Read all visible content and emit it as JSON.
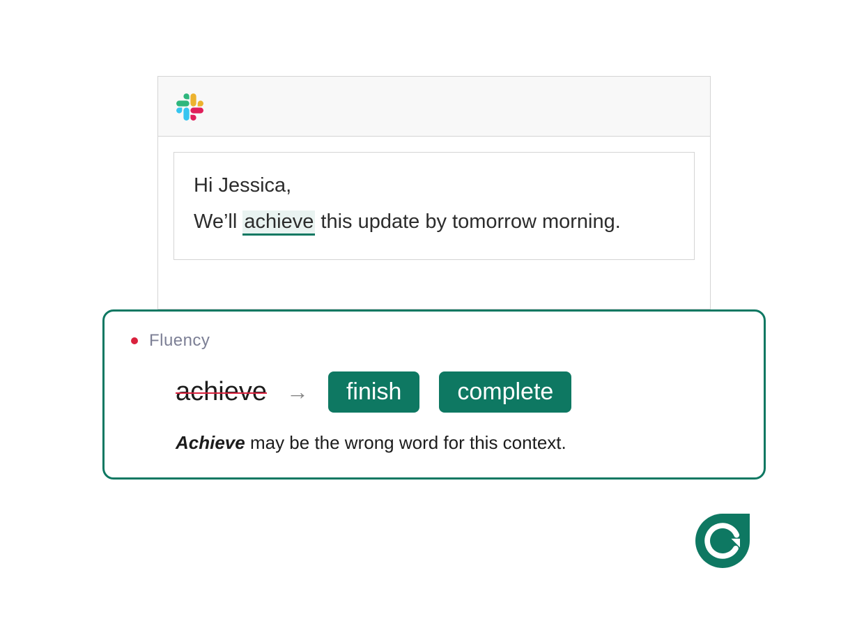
{
  "message": {
    "greeting": "Hi Jessica,",
    "sentence_pre": "We’ll ",
    "highlight": "achieve",
    "sentence_post": " this update by tomorrow morning."
  },
  "card": {
    "category": "Fluency",
    "strike_word": "achieve",
    "suggestions": [
      "finish",
      "complete"
    ],
    "explanation_bold": "Achieve",
    "explanation_rest": " may be the wrong word for this context."
  }
}
